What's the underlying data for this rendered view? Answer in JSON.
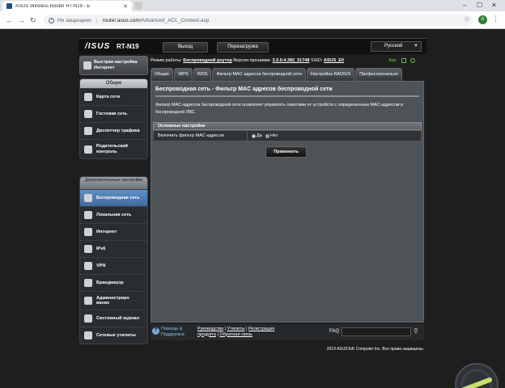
{
  "browser": {
    "tab_title": "ASUS Wireless Router RT-N19 - Б",
    "url_insecure": "Не защищено",
    "url_host": "router.asus.com",
    "url_path": "/Advanced_ACL_Content.asp",
    "profile_letter": "A"
  },
  "header": {
    "brand": "/ISUS",
    "model": "RT-N19",
    "logout": "Выход",
    "reboot": "Перезагрузка",
    "language": "Русский"
  },
  "status": {
    "mode_label": "Режим работы:",
    "mode_value": "Беспроводной роутер",
    "fw_label": "Версия прошивки:",
    "fw_value": "3.0.0.4.382_51748",
    "ssid_label": "SSID:",
    "ssid_value": "ASUS_E0",
    "app": "App"
  },
  "sidebar": {
    "qis": "Быстрая настройка Интернет",
    "general_header": "Общее",
    "general": [
      "Карта сети",
      "Гостевая сеть",
      "Диспетчер трафика",
      "Родительский контроль"
    ],
    "advanced_header": "Дополнительные настройки",
    "advanced": [
      "Беспроводная сеть",
      "Локальная сеть",
      "Интернет",
      "IPv6",
      "VPN",
      "Брандмауэр",
      "Администрирование",
      "Системный журнал",
      "Сетевые утилиты"
    ]
  },
  "tabs": [
    "Общие",
    "WPS",
    "WDS",
    "Фильтр MAC адресов беспроводной сети",
    "Настройка RADIUS",
    "Профессионально"
  ],
  "content": {
    "title": "Беспроводная сеть - Фильтр MAC адресов беспроводной сети",
    "description": "Фильтр MAC-адресов беспроводной сети позволяет управлять пакетами от устройств с определенным MAC-адресом в беспроводной ЛВС.",
    "section_header": "Основные настройки",
    "enable_label": "Включить фильтр MAC-адресов",
    "opt_yes": "Да",
    "opt_no": "Нет",
    "selected": "Нет",
    "apply": "Применить"
  },
  "footer": {
    "help_line1": "Помощь &",
    "help_line2": "Поддержка",
    "manual": "Руководство",
    "utilities": "Утилиты",
    "registration": "Регистрация",
    "product": "продукта",
    "feedback": "Обратная связь",
    "faq": "FAQ",
    "copyright": "2019 ASUSTeK Computer Inc. Все права защищены."
  },
  "icons": {
    "qis": "wand-icon",
    "general": [
      "network-map-icon",
      "guest-network-icon",
      "traffic-manager-icon",
      "parental-control-icon"
    ],
    "advanced": [
      "wireless-icon",
      "lan-icon",
      "wan-icon",
      "ipv6-icon",
      "vpn-icon",
      "firewall-icon",
      "administration-icon",
      "system-log-icon",
      "network-tools-icon"
    ]
  },
  "colors": {
    "selected_menu": "#4f7fb4",
    "panel_bg": "#4d5357",
    "accent_green": "#6cc04a"
  }
}
